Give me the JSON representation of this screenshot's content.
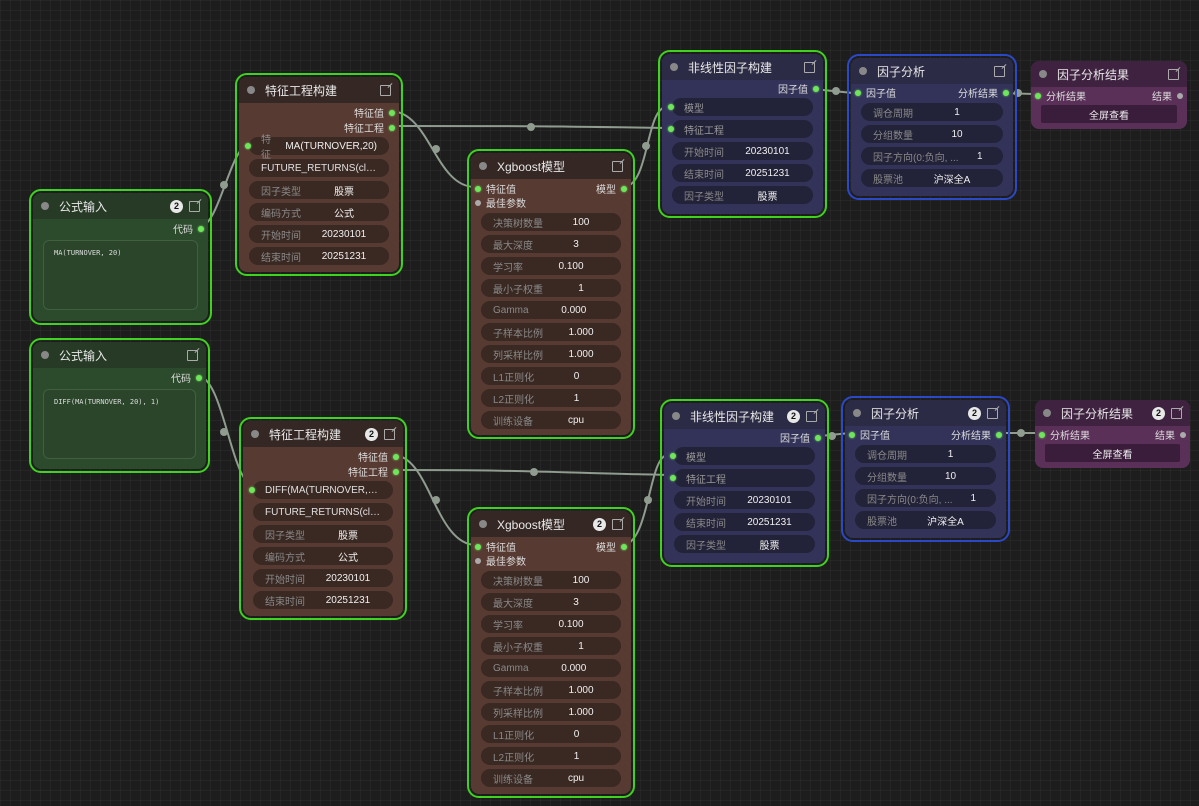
{
  "nodes": {
    "fe1": {
      "title": "特征工程构建",
      "outputs": [
        "特征值",
        "特征工程"
      ],
      "widgets": [
        {
          "label": "特征",
          "value": "MA(TURNOVER,20)"
        },
        {
          "label": "",
          "value": "FUTURE_RETURNS(clos..."
        },
        {
          "label": "因子类型",
          "value": "股票"
        },
        {
          "label": "编码方式",
          "value": "公式"
        },
        {
          "label": "开始时间",
          "value": "20230101"
        },
        {
          "label": "结束时间",
          "value": "20251231"
        }
      ]
    },
    "fe2": {
      "title": "特征工程构建",
      "badge": "2",
      "outputs": [
        "特征值",
        "特征工程"
      ],
      "widgets": [
        {
          "label": "",
          "value": "DIFF(MA(TURNOVER,20)..."
        },
        {
          "label": "",
          "value": "FUTURE_RETURNS(clos..."
        },
        {
          "label": "因子类型",
          "value": "股票"
        },
        {
          "label": "编码方式",
          "value": "公式"
        },
        {
          "label": "开始时间",
          "value": "20230101"
        },
        {
          "label": "结束时间",
          "value": "20251231"
        }
      ]
    },
    "fi1": {
      "title": "公式输入",
      "badge": "2",
      "output": "代码",
      "code": "MA(TURNOVER, 20)"
    },
    "fi2": {
      "title": "公式输入",
      "output": "代码",
      "code": "DIFF(MA(TURNOVER, 20), 1)"
    },
    "xgb1": {
      "title": "Xgboost模型",
      "input": "特征值",
      "output": "模型",
      "input2": "最佳参数",
      "widgets": [
        {
          "label": "决策树数量",
          "value": "100"
        },
        {
          "label": "最大深度",
          "value": "3"
        },
        {
          "label": "学习率",
          "value": "0.100"
        },
        {
          "label": "最小子权重",
          "value": "1"
        },
        {
          "label": "Gamma",
          "value": "0.000"
        },
        {
          "label": "子样本比例",
          "value": "1.000"
        },
        {
          "label": "列采样比例",
          "value": "1.000"
        },
        {
          "label": "L1正则化",
          "value": "0"
        },
        {
          "label": "L2正则化",
          "value": "1"
        },
        {
          "label": "训练设备",
          "value": "cpu"
        }
      ]
    },
    "xgb2": {
      "title": "Xgboost模型",
      "badge": "2",
      "input": "特征值",
      "output": "模型",
      "input2": "最佳参数",
      "widgets": [
        {
          "label": "决策树数量",
          "value": "100"
        },
        {
          "label": "最大深度",
          "value": "3"
        },
        {
          "label": "学习率",
          "value": "0.100"
        },
        {
          "label": "最小子权重",
          "value": "1"
        },
        {
          "label": "Gamma",
          "value": "0.000"
        },
        {
          "label": "子样本比例",
          "value": "1.000"
        },
        {
          "label": "列采样比例",
          "value": "1.000"
        },
        {
          "label": "L1正则化",
          "value": "0"
        },
        {
          "label": "L2正则化",
          "value": "1"
        },
        {
          "label": "训练设备",
          "value": "cpu"
        }
      ]
    },
    "nl1": {
      "title": "非线性因子构建",
      "output": "因子值",
      "sockets": [
        "模型",
        "特征工程"
      ],
      "widgets": [
        {
          "label": "开始时间",
          "value": "20230101"
        },
        {
          "label": "结束时间",
          "value": "20251231"
        },
        {
          "label": "因子类型",
          "value": "股票"
        }
      ]
    },
    "nl2": {
      "title": "非线性因子构建",
      "badge": "2",
      "output": "因子值",
      "sockets": [
        "模型",
        "特征工程"
      ],
      "widgets": [
        {
          "label": "开始时间",
          "value": "20230101"
        },
        {
          "label": "结束时间",
          "value": "20251231"
        },
        {
          "label": "因子类型",
          "value": "股票"
        }
      ]
    },
    "fa1": {
      "title": "因子分析",
      "input": "因子值",
      "output": "分析结果",
      "widgets": [
        {
          "label": "调仓周期",
          "value": "1"
        },
        {
          "label": "分组数量",
          "value": "10"
        },
        {
          "label": "因子方向(0:负向, ...",
          "value": "1"
        },
        {
          "label": "股票池",
          "value": "沪深全A"
        }
      ]
    },
    "fa2": {
      "title": "因子分析",
      "badge": "2",
      "input": "因子值",
      "output": "分析结果",
      "widgets": [
        {
          "label": "调仓周期",
          "value": "1"
        },
        {
          "label": "分组数量",
          "value": "10"
        },
        {
          "label": "因子方向(0:负向, ...",
          "value": "1"
        },
        {
          "label": "股票池",
          "value": "沪深全A"
        }
      ]
    },
    "fr1": {
      "title": "因子分析结果",
      "input": "分析结果",
      "output": "结果",
      "button": "全屏查看"
    },
    "fr2": {
      "title": "因子分析结果",
      "badge": "2",
      "input": "分析结果",
      "output": "结果",
      "button": "全屏查看"
    }
  },
  "colors": {
    "wire": "#8f9c8f",
    "slot": "#6ee55a",
    "selection": "#3fd21f",
    "selection_blue": "#2b48c8"
  }
}
